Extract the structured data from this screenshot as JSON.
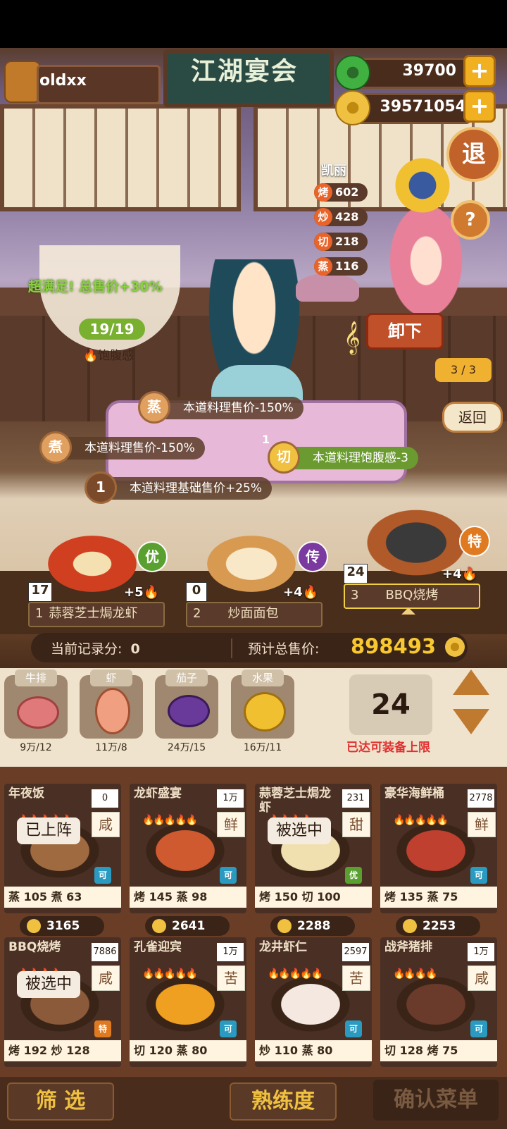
{
  "player": {
    "name": "oldxx"
  },
  "title": "江湖宴会",
  "currency": {
    "jade": "39700",
    "coins": "39571054"
  },
  "character": {
    "name": "凯丽",
    "stats": [
      {
        "key": "烤",
        "value": "602"
      },
      {
        "key": "炒",
        "value": "428"
      },
      {
        "key": "切",
        "value": "218"
      },
      {
        "key": "蒸",
        "value": "116"
      }
    ],
    "unload_label": "卸下"
  },
  "buttons": {
    "exit": "退",
    "help": "?",
    "back": "返回",
    "page": "3 / 3"
  },
  "satisfaction": {
    "text": "超满足! 总售价+30%",
    "count": "19/19",
    "label": "饱腹感"
  },
  "effects": [
    {
      "icon": "蒸",
      "text": "本道料理售价-150%"
    },
    {
      "icon": "煮",
      "text": "本道料理售价-150%"
    },
    {
      "icon": "切",
      "num": "1",
      "text": "本道料理饱腹感-3"
    },
    {
      "icon": "1",
      "text": "本道料理基础售价+25%"
    }
  ],
  "slots": [
    {
      "index": "1",
      "name": "蒜蓉芝士焗龙虾",
      "count": "17",
      "bonus": "+5",
      "badge": "优",
      "badge_color": "#5aa030"
    },
    {
      "index": "2",
      "name": "炒面面包",
      "count": "0",
      "bonus": "+4",
      "badge": "传",
      "badge_color": "#7a3aa0"
    },
    {
      "index": "3",
      "name": "BBQ烧烤",
      "count": "24",
      "bonus": "+4",
      "badge": "特",
      "badge_color": "#e07a20"
    }
  ],
  "score": {
    "label": "当前记录分:",
    "value": "0",
    "total_label": "预计总售价:",
    "total_value": "898493"
  },
  "ingredients": [
    {
      "name": "牛排",
      "count": "9万/12",
      "icon": "steak-icon"
    },
    {
      "name": "虾",
      "count": "11万/8",
      "icon": "shrimp-icon"
    },
    {
      "name": "茄子",
      "count": "24万/15",
      "icon": "eggplant-icon"
    },
    {
      "name": "水果",
      "count": "16万/11",
      "icon": "fruit-icon"
    }
  ],
  "limit": {
    "value": "24",
    "note": "已达可装备上限"
  },
  "recipes": [
    {
      "name": "年夜饭",
      "num": "0",
      "taste": "咸",
      "status": "已上阵",
      "tag": "可",
      "skill1": "蒸",
      "v1": "105",
      "skill2": "煮",
      "v2": "63",
      "price": "3165",
      "flames": "🔥🔥🔥🔥🔥"
    },
    {
      "name": "龙虾盛宴",
      "num": "1万",
      "taste": "鲜",
      "status": "",
      "tag": "可",
      "skill1": "烤",
      "v1": "145",
      "skill2": "蒸",
      "v2": "98",
      "price": "2641",
      "flames": "🔥🔥🔥🔥🔥"
    },
    {
      "name": "蒜蓉芝士焗龙虾",
      "num": "231",
      "taste": "甜",
      "status": "被选中",
      "tag": "优",
      "skill1": "烤",
      "v1": "150",
      "skill2": "切",
      "v2": "100",
      "price": "2288",
      "flames": "🔥🔥🔥🔥"
    },
    {
      "name": "豪华海鲜桶",
      "num": "2778",
      "taste": "鲜",
      "status": "",
      "tag": "可",
      "skill1": "烤",
      "v1": "135",
      "skill2": "蒸",
      "v2": "75",
      "price": "2253",
      "flames": "🔥🔥🔥🔥🔥"
    },
    {
      "name": "BBQ烧烤",
      "num": "7886",
      "taste": "咸",
      "status": "被选中",
      "tag": "特",
      "skill1": "烤",
      "v1": "192",
      "skill2": "炒",
      "v2": "128",
      "price": "",
      "flames": "🔥🔥🔥🔥"
    },
    {
      "name": "孔雀迎宾",
      "num": "1万",
      "taste": "苦",
      "status": "",
      "tag": "可",
      "skill1": "切",
      "v1": "120",
      "skill2": "蒸",
      "v2": "80",
      "price": "",
      "flames": "🔥🔥🔥🔥🔥"
    },
    {
      "name": "龙井虾仁",
      "num": "2597",
      "taste": "苦",
      "status": "",
      "tag": "可",
      "skill1": "炒",
      "v1": "110",
      "skill2": "蒸",
      "v2": "80",
      "price": "",
      "flames": "🔥🔥🔥🔥🔥"
    },
    {
      "name": "战斧猪排",
      "num": "1万",
      "taste": "咸",
      "status": "",
      "tag": "可",
      "skill1": "切",
      "v1": "128",
      "skill2": "烤",
      "v2": "75",
      "price": "",
      "flames": "🔥🔥🔥🔥"
    }
  ],
  "bottom": {
    "filter": "筛 选",
    "proficiency": "熟练度",
    "confirm": "确认菜单"
  }
}
